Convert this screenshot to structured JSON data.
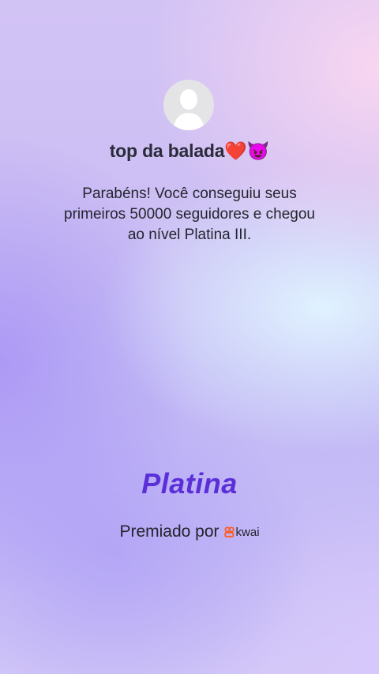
{
  "profile": {
    "username": "top da balada",
    "username_emojis": "❤️😈"
  },
  "message": {
    "line1": "Parabéns! Você conseguiu seus",
    "line2": "primeiros 50000 seguidores e chegou",
    "line3": "ao nível Platina III."
  },
  "badge": {
    "title": "Platina",
    "color": "#5a2fd8"
  },
  "award": {
    "label": "Premiado por",
    "brand": "kwai",
    "brand_icon": "kwai-logo-icon",
    "brand_color": "#ff5a1f"
  }
}
